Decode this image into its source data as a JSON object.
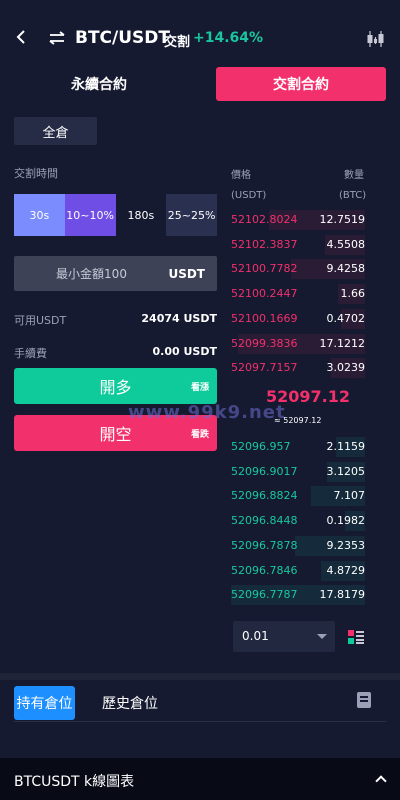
{
  "header": {
    "pair": "BTC/USDT",
    "mode": "交割",
    "change": "+14.64%"
  },
  "contract_tabs": {
    "perpetual": "永續合約",
    "delivery": "交割合約"
  },
  "margin_mode": "全倉",
  "delivery_time": {
    "label": "交割時間",
    "options": [
      {
        "time": "30s",
        "color": "#7b8cff"
      },
      {
        "time": "10~10%",
        "color": "#6f4ee6"
      },
      {
        "time": "180s",
        "color": "#151a30"
      },
      {
        "time": "25~25%",
        "color": "#2a3050"
      }
    ]
  },
  "amount": {
    "placeholder": "最小金額100",
    "unit": "USDT"
  },
  "available": {
    "label": "可用USDT",
    "value": "24074 USDT"
  },
  "fee": {
    "label": "手續費",
    "value": "0.00 USDT"
  },
  "buttons": {
    "long": {
      "label": "開多",
      "tag": "看漲"
    },
    "short": {
      "label": "開空",
      "tag": "看跌"
    }
  },
  "orderbook": {
    "price_header": "價格",
    "qty_header": "數量",
    "price_unit": "(USDT)",
    "qty_unit": "(BTC)",
    "asks": [
      {
        "price": "52102.8024",
        "qty": "12.7519",
        "depth": 0.72
      },
      {
        "price": "52102.3837",
        "qty": "4.5508",
        "depth": 0.3
      },
      {
        "price": "52100.7782",
        "qty": "9.4258",
        "depth": 0.55
      },
      {
        "price": "52100.2447",
        "qty": "1.66",
        "depth": 0.2
      },
      {
        "price": "52100.1669",
        "qty": "0.4702",
        "depth": 0.18
      },
      {
        "price": "52099.3836",
        "qty": "17.1212",
        "depth": 0.95
      },
      {
        "price": "52097.7157",
        "qty": "3.0239",
        "depth": 0.25
      }
    ],
    "last_price": "52097.12",
    "ref_price": "≈ 52097.12",
    "bids": [
      {
        "price": "52096.957",
        "qty": "2.1159",
        "depth": 0.22
      },
      {
        "price": "52096.9017",
        "qty": "3.1205",
        "depth": 0.28
      },
      {
        "price": "52096.8824",
        "qty": "7.107",
        "depth": 0.4
      },
      {
        "price": "52096.8448",
        "qty": "0.1982",
        "depth": 0.15
      },
      {
        "price": "52096.7878",
        "qty": "9.2353",
        "depth": 0.52
      },
      {
        "price": "52096.7846",
        "qty": "4.8729",
        "depth": 0.33
      },
      {
        "price": "52096.7787",
        "qty": "17.8179",
        "depth": 1.0
      }
    ]
  },
  "depth_select": {
    "value": "0.01"
  },
  "watermark": "www.99k9.net",
  "position_tabs": {
    "holding": "持有倉位",
    "history": "歷史倉位"
  },
  "footer": {
    "title": "BTCUSDT  k線圖表"
  }
}
